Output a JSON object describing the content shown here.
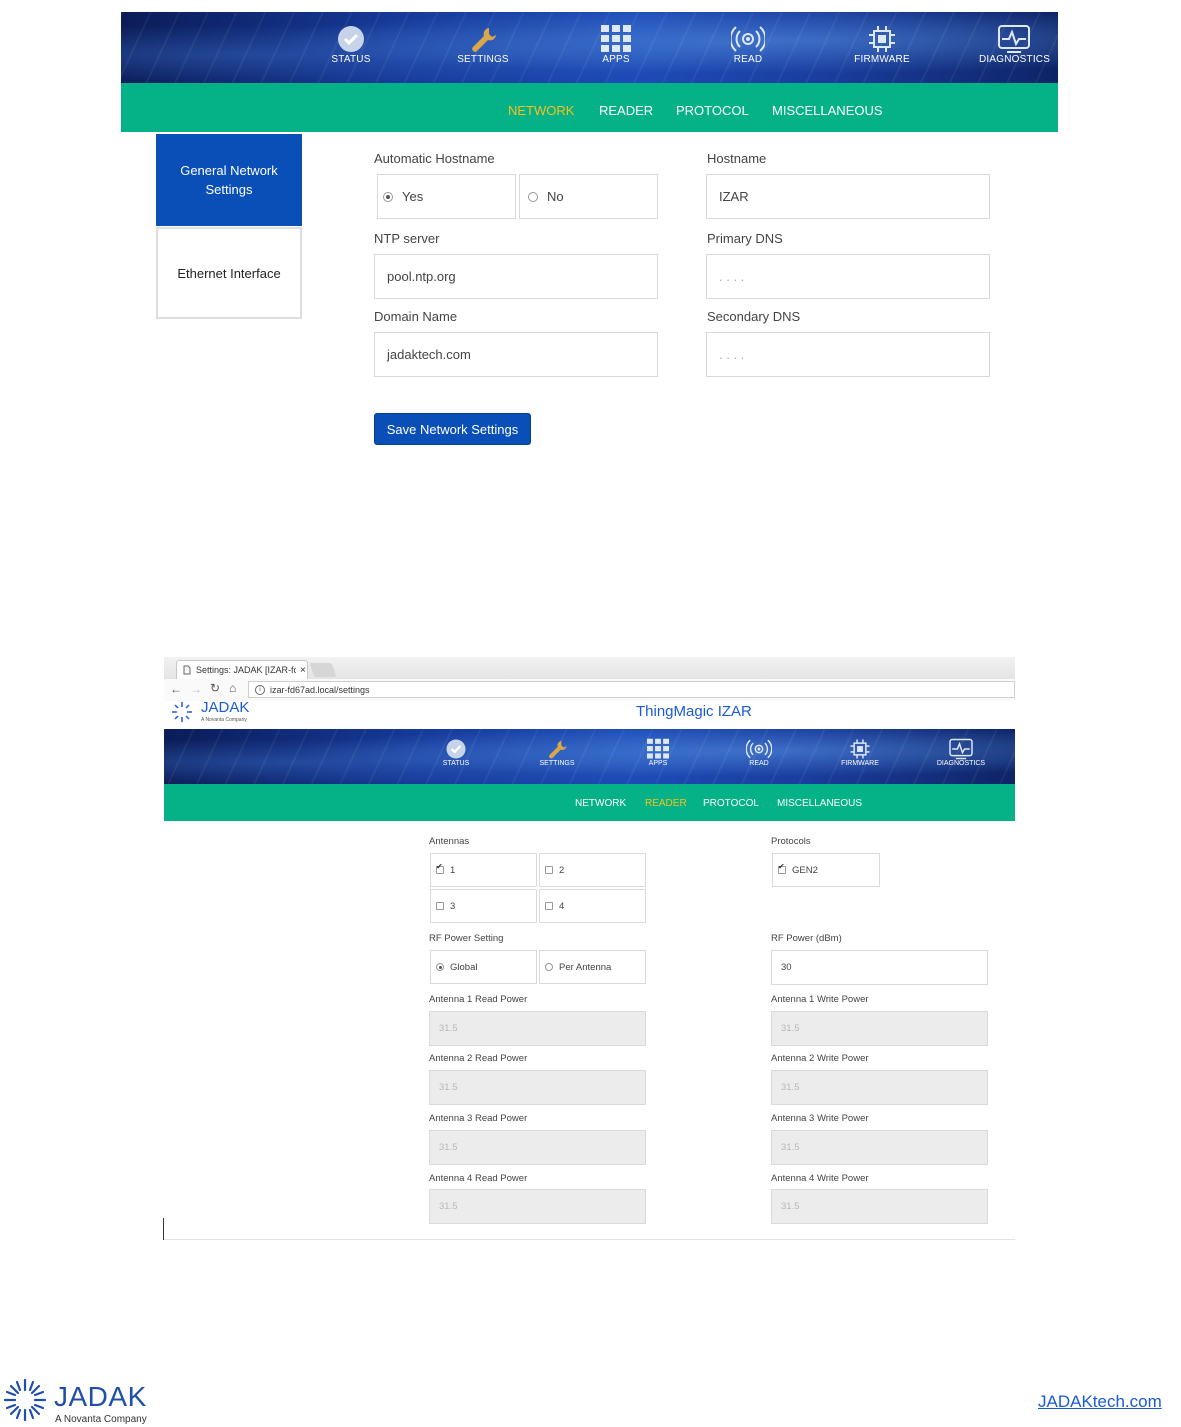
{
  "main_nav": {
    "items": [
      {
        "label": "STATUS",
        "icon": "check-circle-icon"
      },
      {
        "label": "SETTINGS",
        "icon": "wrench-icon"
      },
      {
        "label": "APPS",
        "icon": "apps-grid-icon"
      },
      {
        "label": "READ",
        "icon": "radio-waves-icon"
      },
      {
        "label": "FIRMWARE",
        "icon": "chip-icon"
      },
      {
        "label": "DIAGNOSTICS",
        "icon": "pulse-monitor-icon"
      }
    ]
  },
  "settings_tabs": [
    "NETWORK",
    "READER",
    "PROTOCOL",
    "MISCELLANEOUS"
  ],
  "network": {
    "active_tab": "NETWORK",
    "sidebar": [
      "General Network Settings",
      "Ethernet Interface"
    ],
    "automatic_hostname": {
      "label": "Automatic Hostname",
      "yes": "Yes",
      "no": "No",
      "selected": "Yes"
    },
    "hostname": {
      "label": "Hostname",
      "value": "IZAR"
    },
    "ntp_server": {
      "label": "NTP server",
      "value": "pool.ntp.org"
    },
    "primary_dns": {
      "label": "Primary DNS",
      "value": ". . . ."
    },
    "domain_name": {
      "label": "Domain Name",
      "value": "jadaktech.com"
    },
    "secondary_dns": {
      "label": "Secondary DNS",
      "value": ". . . ."
    },
    "save_button": "Save Network Settings"
  },
  "browser": {
    "tab_title": "Settings: JADAK [IZAR-fc",
    "tab_close": "×",
    "url": "izar-fd67ad.local/settings",
    "logo_text": "JADAK",
    "logo_sub": "A Novanta Company",
    "page_title": "ThingMagic IZAR"
  },
  "reader": {
    "active_tab": "READER",
    "antennas": {
      "label": "Antennas",
      "items": [
        {
          "label": "1",
          "checked": true
        },
        {
          "label": "2",
          "checked": false
        },
        {
          "label": "3",
          "checked": false
        },
        {
          "label": "4",
          "checked": false
        }
      ]
    },
    "protocols": {
      "label": "Protocols",
      "items": [
        {
          "label": "GEN2",
          "checked": true
        }
      ]
    },
    "rf_power_setting": {
      "label": "RF Power Setting",
      "global": "Global",
      "per_antenna": "Per Antenna",
      "selected": "Global"
    },
    "rf_power": {
      "label": "RF Power (dBm)",
      "value": "30"
    },
    "antenna_powers": [
      {
        "read_label": "Antenna 1 Read Power",
        "read_value": "31.5",
        "write_label": "Antenna 1 Write Power",
        "write_value": "31.5"
      },
      {
        "read_label": "Antenna 2 Read Power",
        "read_value": "31.5",
        "write_label": "Antenna 2 Write Power",
        "write_value": "31.5"
      },
      {
        "read_label": "Antenna 3 Read Power",
        "read_value": "31.5",
        "write_label": "Antenna 3 Write Power",
        "write_value": "31.5"
      },
      {
        "read_label": "Antenna 4 Read Power",
        "read_value": "31.5",
        "write_label": "Antenna 4 Write Power",
        "write_value": "31.5"
      }
    ]
  },
  "footer": {
    "logo_text": "JADAK",
    "logo_sub": "A Novanta Company",
    "link": "JADAKtech.com"
  },
  "colors": {
    "green": "#05b287",
    "blue": "#0a4fb8",
    "active_tab": "#f4c21b",
    "link": "#1a5bd6"
  }
}
